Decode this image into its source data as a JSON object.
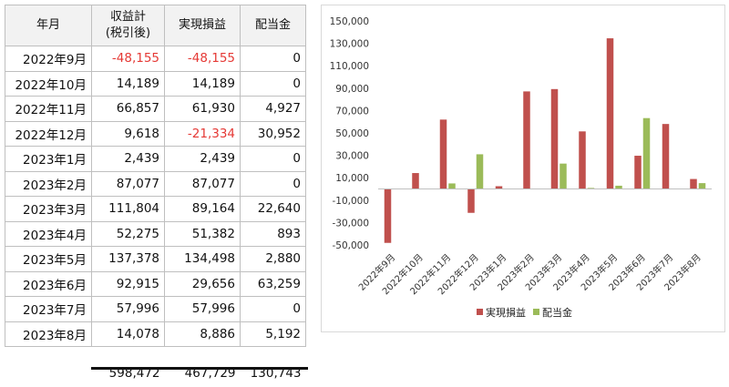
{
  "table": {
    "headers": {
      "month": "年月",
      "income": "収益計",
      "income_sub": "(税引後)",
      "realized": "実現損益",
      "dividend": "配当金"
    },
    "rows": [
      {
        "month": "2022年9月",
        "income": "-48,155",
        "realized": "-48,155",
        "dividend": "0"
      },
      {
        "month": "2022年10月",
        "income": "14,189",
        "realized": "14,189",
        "dividend": "0"
      },
      {
        "month": "2022年11月",
        "income": "66,857",
        "realized": "61,930",
        "dividend": "4,927"
      },
      {
        "month": "2022年12月",
        "income": "9,618",
        "realized": "-21,334",
        "dividend": "30,952"
      },
      {
        "month": "2023年1月",
        "income": "2,439",
        "realized": "2,439",
        "dividend": "0"
      },
      {
        "month": "2023年2月",
        "income": "87,077",
        "realized": "87,077",
        "dividend": "0"
      },
      {
        "month": "2023年3月",
        "income": "111,804",
        "realized": "89,164",
        "dividend": "22,640"
      },
      {
        "month": "2023年4月",
        "income": "52,275",
        "realized": "51,382",
        "dividend": "893"
      },
      {
        "month": "2023年5月",
        "income": "137,378",
        "realized": "134,498",
        "dividend": "2,880"
      },
      {
        "month": "2023年6月",
        "income": "92,915",
        "realized": "29,656",
        "dividend": "63,259"
      },
      {
        "month": "2023年7月",
        "income": "57,996",
        "realized": "57,996",
        "dividend": "0"
      },
      {
        "month": "2023年8月",
        "income": "14,078",
        "realized": "8,886",
        "dividend": "5,192"
      }
    ],
    "totals": {
      "income": "598,472",
      "realized": "467,729",
      "dividend": "130,743"
    }
  },
  "colors": {
    "realized": "#c0504d",
    "dividend": "#9bbb59",
    "negative_text": "#e53935"
  },
  "chart_data": {
    "type": "bar",
    "categories": [
      "2022年9月",
      "2022年10月",
      "2022年11月",
      "2022年12月",
      "2023年1月",
      "2023年2月",
      "2023年3月",
      "2023年4月",
      "2023年5月",
      "2023年6月",
      "2023年7月",
      "2023年8月"
    ],
    "series": [
      {
        "name": "実現損益",
        "values": [
          -48155,
          14189,
          61930,
          -21334,
          2439,
          87077,
          89164,
          51382,
          134498,
          29656,
          57996,
          8886
        ]
      },
      {
        "name": "配当金",
        "values": [
          0,
          0,
          4927,
          30952,
          0,
          0,
          22640,
          893,
          2880,
          63259,
          0,
          5192
        ]
      }
    ],
    "ylim": [
      -50000,
      150000
    ],
    "yticks": [
      -50000,
      -30000,
      -10000,
      10000,
      30000,
      50000,
      70000,
      90000,
      110000,
      130000,
      150000
    ],
    "ytick_labels": [
      "-50,000",
      "-30,000",
      "-10,000",
      "10,000",
      "30,000",
      "50,000",
      "70,000",
      "90,000",
      "110,000",
      "130,000",
      "150,000"
    ],
    "grid": false,
    "legend_position": "bottom"
  }
}
